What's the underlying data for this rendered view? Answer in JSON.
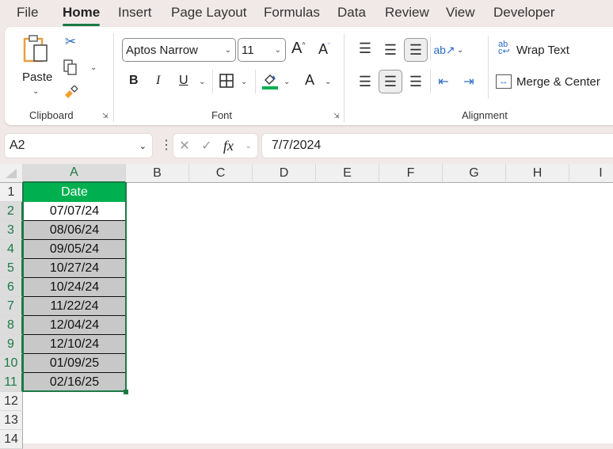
{
  "tabs": [
    "File",
    "Home",
    "Insert",
    "Page Layout",
    "Formulas",
    "Data",
    "Review",
    "View",
    "Developer"
  ],
  "active_tab": "Home",
  "clipboard": {
    "paste_label": "Paste",
    "group_label": "Clipboard",
    "icons": [
      "cut-icon",
      "copy-icon",
      "format-painter-icon"
    ]
  },
  "font": {
    "name": "Aptos Narrow",
    "size": "11",
    "group_label": "Font",
    "bold": "B",
    "italic": "I",
    "underline": "U",
    "font_color_glyph": "A",
    "grow_glyph": "A",
    "shrink_glyph": "A",
    "fill_color": "#00b050"
  },
  "alignment": {
    "group_label": "Alignment",
    "wrap_text": "Wrap Text",
    "merge_center": "Merge & Center",
    "active_vertical": "bottom",
    "active_horizontal": "center"
  },
  "formula_bar": {
    "name_box": "A2",
    "formula": "7/7/2024",
    "fx": "fx"
  },
  "columns": [
    "A",
    "B",
    "C",
    "D",
    "E",
    "F",
    "G",
    "H",
    "I"
  ],
  "selected_column": "A",
  "rows": [
    "1",
    "2",
    "3",
    "4",
    "5",
    "6",
    "7",
    "8",
    "9",
    "10",
    "11",
    "12",
    "13",
    "14"
  ],
  "sheet": {
    "header": "Date",
    "dates": [
      "07/07/24",
      "08/06/24",
      "09/05/24",
      "10/27/24",
      "10/24/24",
      "11/22/24",
      "12/04/24",
      "12/10/24",
      "01/09/25",
      "02/16/25"
    ],
    "header_color": "#00b050",
    "selection_color": "#1c7a44"
  }
}
